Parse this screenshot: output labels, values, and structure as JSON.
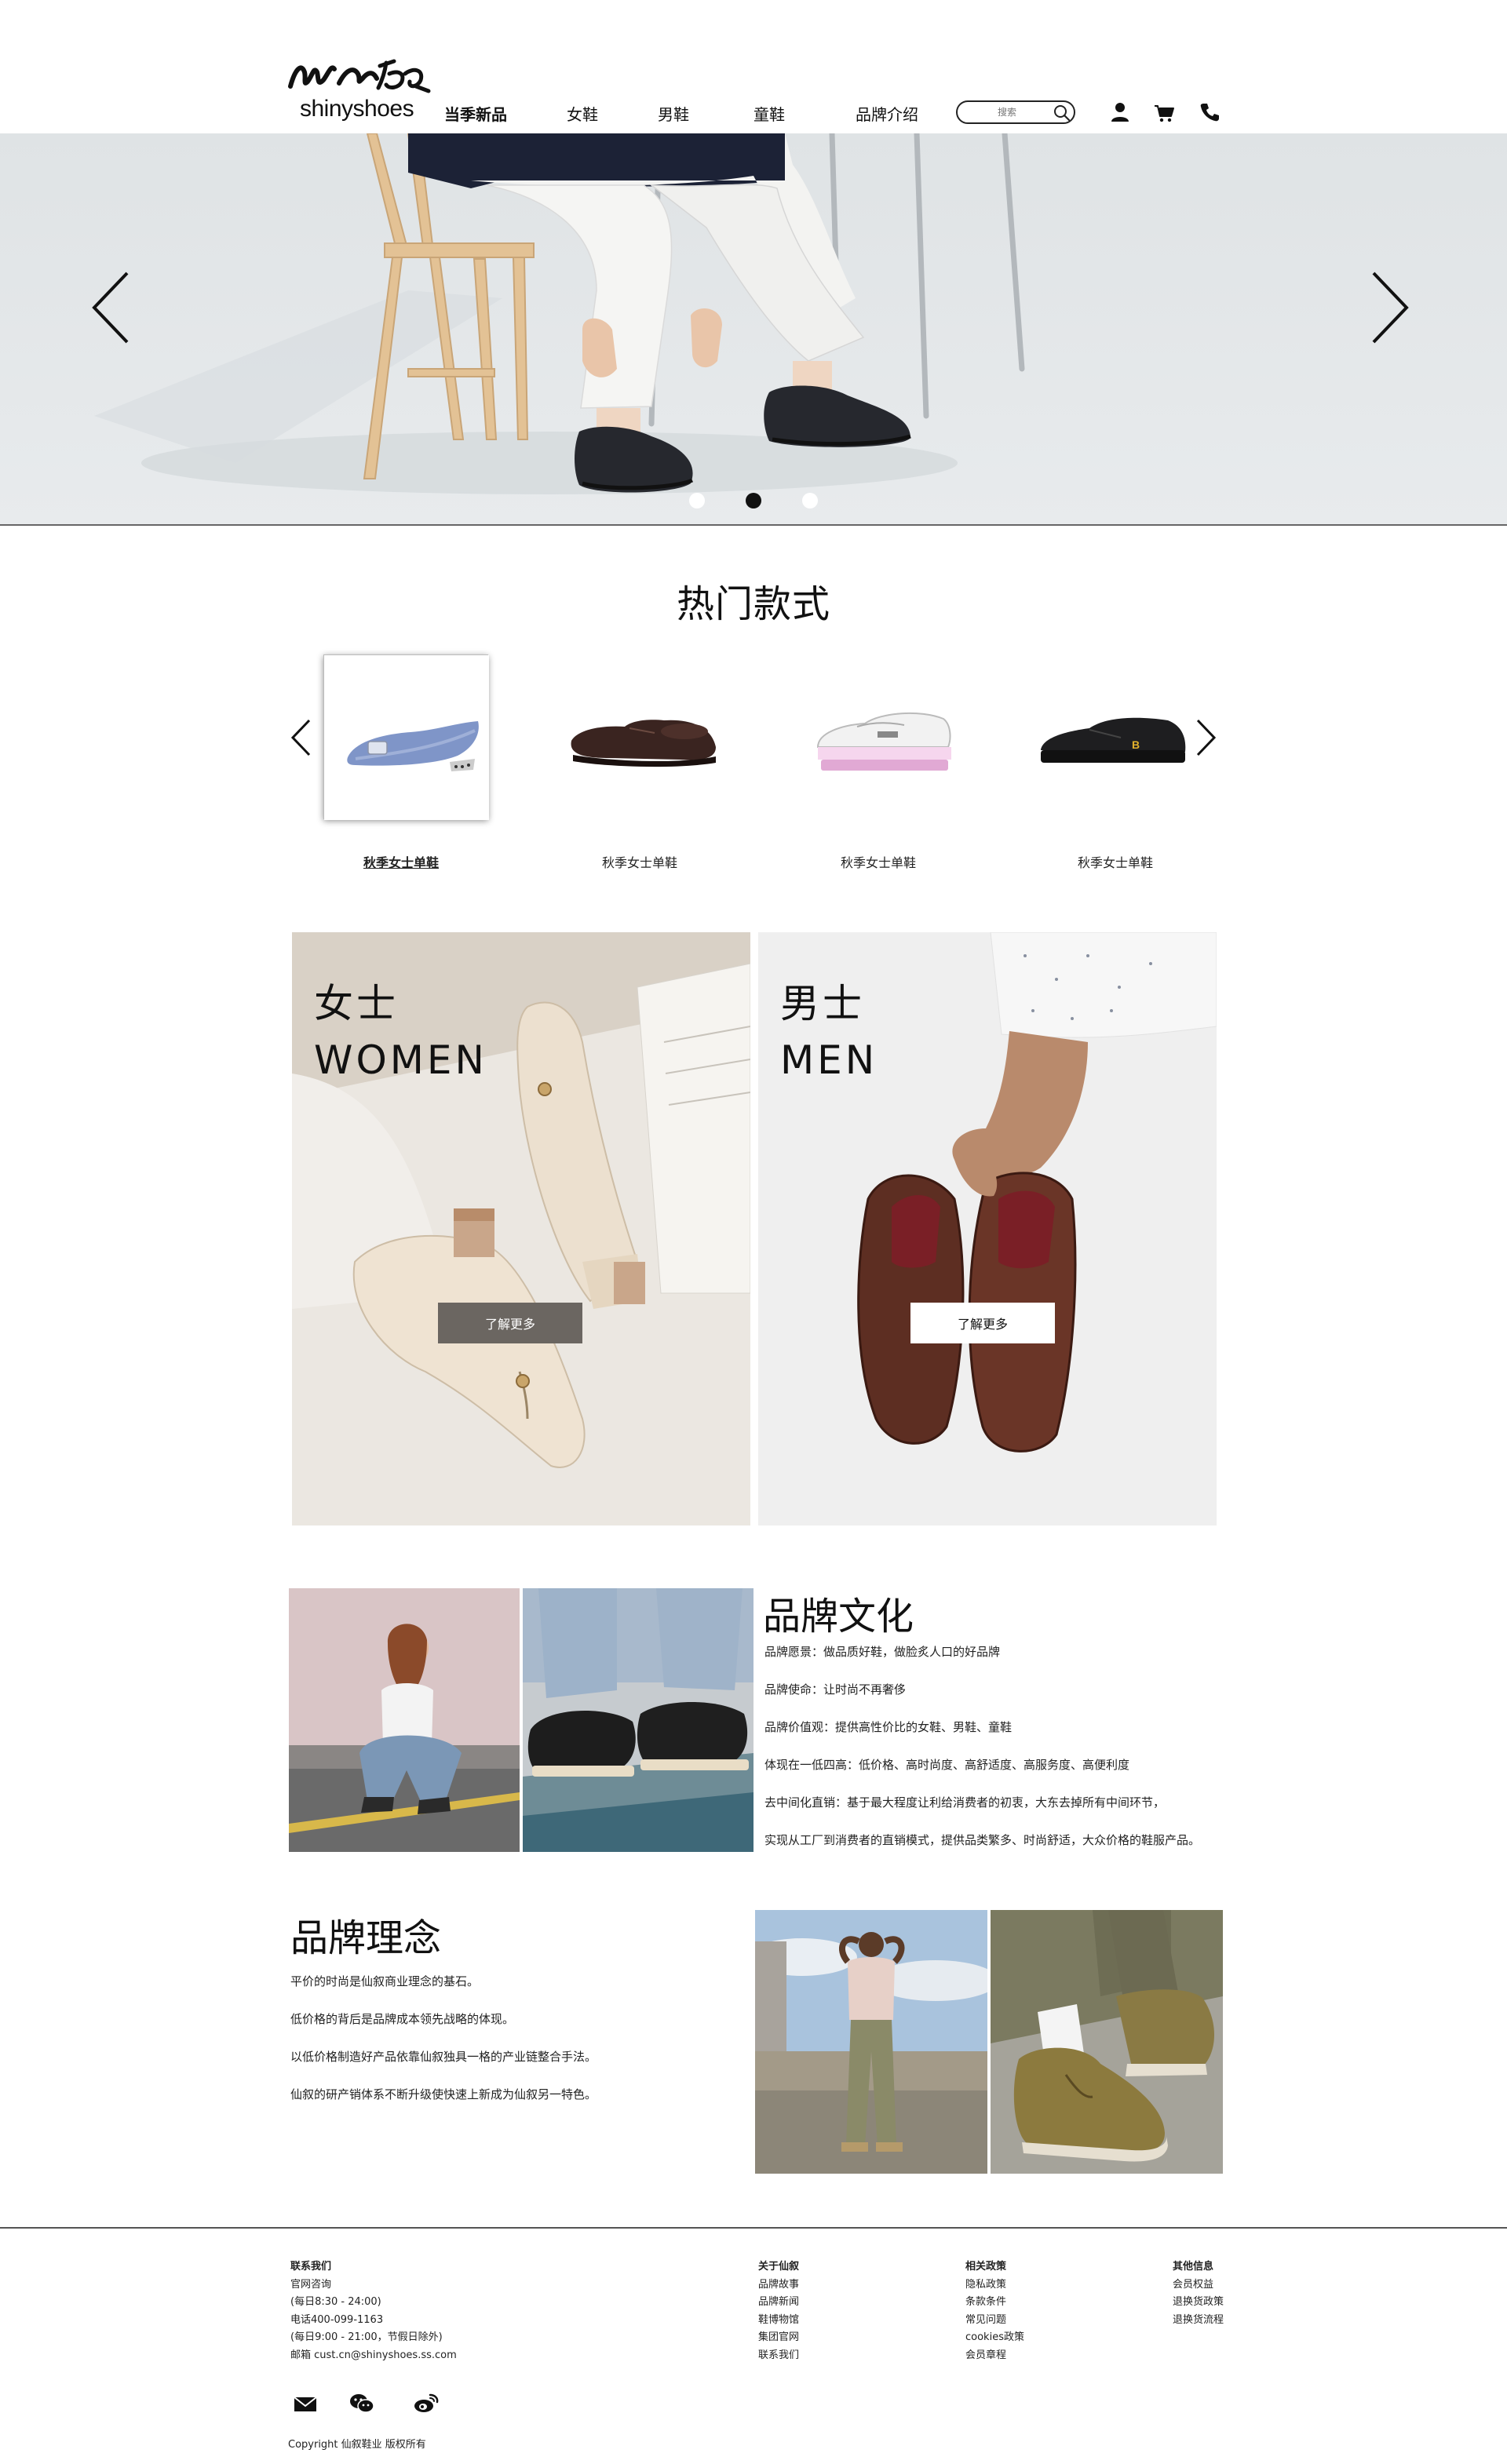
{
  "brand": {
    "logo_script": "仙叙",
    "logo_text": "shinyshoes"
  },
  "nav": {
    "items": [
      {
        "label": "当季新品",
        "active": true
      },
      {
        "label": "女鞋",
        "active": false
      },
      {
        "label": "男鞋",
        "active": false
      },
      {
        "label": "童鞋",
        "active": false
      },
      {
        "label": "品牌介绍",
        "active": false
      }
    ],
    "search_placeholder": "搜索",
    "icons": [
      "user-icon",
      "cart-icon",
      "phone-icon"
    ]
  },
  "hero": {
    "slide_count": 3,
    "active_slide": 2,
    "colors": {
      "background": "#e1e4e6",
      "trousers": "#f4f4f2",
      "jacket": "#1c2236",
      "shoe": "#26282e",
      "chair": "#e5c49a"
    }
  },
  "hot": {
    "title": "热门款式",
    "products": [
      {
        "label": "秋季女士单鞋",
        "selected": true,
        "icon": "blue-flat-shoe"
      },
      {
        "label": "秋季女士单鞋",
        "selected": false,
        "icon": "brown-oxford-shoe"
      },
      {
        "label": "秋季女士单鞋",
        "selected": false,
        "icon": "pink-platform-sneaker"
      },
      {
        "label": "秋季女士单鞋",
        "selected": false,
        "icon": "black-sneaker"
      }
    ]
  },
  "categories": [
    {
      "title_cn": "女士",
      "title_en": "WOMEN",
      "button": "了解更多"
    },
    {
      "title_cn": "男士",
      "title_en": "MEN",
      "button": "了解更多"
    }
  ],
  "brand_culture": {
    "title": "品牌文化",
    "lines": [
      "品牌愿景：做品质好鞋，做脸炙人口的好品牌",
      "品牌使命：让时尚不再奢侈",
      "品牌价值观：提供高性价比的女鞋、男鞋、童鞋",
      "体现在一低四高：低价格、高时尚度、高舒适度、高服务度、高便利度",
      "去中间化直销：基于最大程度让利给消费者的初衷，大东去掉所有中间环节，",
      "实现从工厂到消费者的直销模式，提供品类繁多、时尚舒适，大众价格的鞋服产品。"
    ]
  },
  "brand_concept": {
    "title": "品牌理念",
    "lines": [
      "平价的时尚是仙叙商业理念的基石。",
      "低价格的背后是品牌成本领先战略的体现。",
      "以低价格制造好产品依靠仙叙独具一格的产业链整合手法。",
      "仙叙的研产销体系不断升级使快速上新成为仙叙另一特色。"
    ]
  },
  "footer": {
    "contact": {
      "heading": "联系我们",
      "lines": [
        "官网咨询",
        "(每日8:30 - 24:00)",
        "电话400-099-1163",
        "(每日9:00 - 21:00，节假日除外)",
        "邮箱 cust.cn@shinyshoes.ss.com"
      ]
    },
    "about": {
      "heading": "关于仙叙",
      "links": [
        "品牌故事",
        "品牌新闻",
        "鞋博物馆",
        "集团官网",
        "联系我们"
      ]
    },
    "policy": {
      "heading": "相关政策",
      "links": [
        "隐私政策",
        "条款条件",
        "常见问题",
        "cookies政策",
        "会员章程"
      ]
    },
    "other": {
      "heading": "其他信息",
      "links": [
        "会员权益",
        "退换货政策",
        "退换货流程"
      ]
    },
    "social_icons": [
      "mail-icon",
      "wechat-icon",
      "weibo-icon"
    ],
    "copyright": "Copyright 仙叙鞋业 版权所有"
  }
}
